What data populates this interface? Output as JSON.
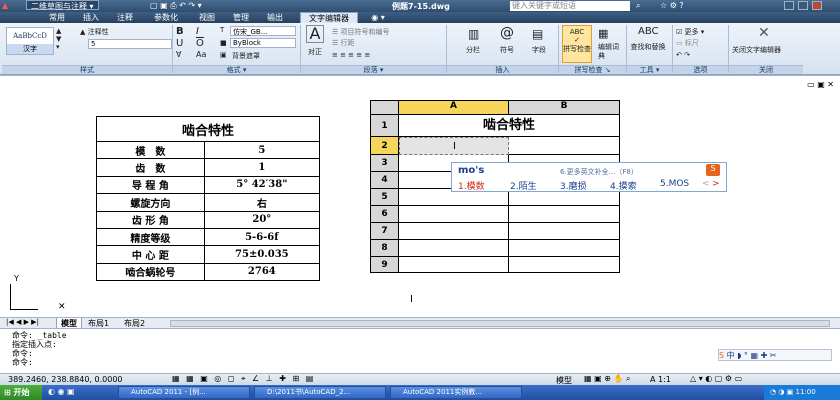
{
  "titlebar": {
    "workspace": "二维草图与注释",
    "filename": "例题7-15.dwg",
    "search_placeholder": "键入关键字或短语"
  },
  "menu_tabs": [
    "常用",
    "插入",
    "注释",
    "参数化",
    "视图",
    "管理",
    "输出",
    "文字编辑器"
  ],
  "ribbon": {
    "style_preview": "AaBbCcD",
    "style_name": "汉字",
    "annotative_label": "注释性",
    "height_value": "5",
    "font_value": "仿宋_GB...",
    "color_value": "ByBlock",
    "background_mask": "背景遮罩",
    "align_label": "对正",
    "bullets_label": "项目符号和编号",
    "line_spacing_label": "行距",
    "columns_label": "分栏",
    "symbol_label": "符号",
    "field_label": "字段",
    "spell_label": "拼写检查",
    "dict_label": "编辑词典",
    "find_label": "查找和替换",
    "more_label": "更多",
    "ruler_label": "标尺",
    "close_label": "关闭文字编辑器",
    "panels": [
      "样式",
      "格式",
      "段落",
      "插入",
      "拼写检查",
      "工具",
      "选项",
      "关闭"
    ]
  },
  "left_table": {
    "title": "啮合特性",
    "rows": [
      [
        "模　数",
        "5"
      ],
      [
        "齿　数",
        "1"
      ],
      [
        "导 程 角",
        "5° 42′38\""
      ],
      [
        "螺旋方向",
        "右"
      ],
      [
        "齿 形 角",
        "20°"
      ],
      [
        "精度等级",
        "5-6-6f"
      ],
      [
        "中 心 距",
        "75±0.035"
      ],
      [
        "啮合蜗轮号",
        "2764"
      ]
    ]
  },
  "sheet": {
    "columns": [
      "A",
      "B"
    ],
    "rows": [
      "1",
      "2",
      "3",
      "4",
      "5",
      "6",
      "7",
      "8",
      "9"
    ],
    "title": "啮合特性"
  },
  "ime": {
    "input": "mo's",
    "more_hint": "6.更多英文补全...（F8）",
    "candidates": [
      "1.模数",
      "2.陌生",
      "3.磨损",
      "4.摸索",
      "5.MOS"
    ]
  },
  "layout_tabs": [
    "模型",
    "布局1",
    "布局2"
  ],
  "command_lines": [
    "命令:  _table",
    "指定插入点:",
    "命令:",
    "命令:"
  ],
  "status": {
    "coords": "389.2460, 238.8840, 0.0000",
    "mode": "模型",
    "scale": "A 1:1",
    "time": "11:00"
  },
  "taskbar": {
    "start": "开始",
    "tasks": [
      "AutoCAD 2011 - [例...",
      "D:\\2011书\\AutoCAD_2...",
      "AutoCAD 2011实例教..."
    ]
  }
}
